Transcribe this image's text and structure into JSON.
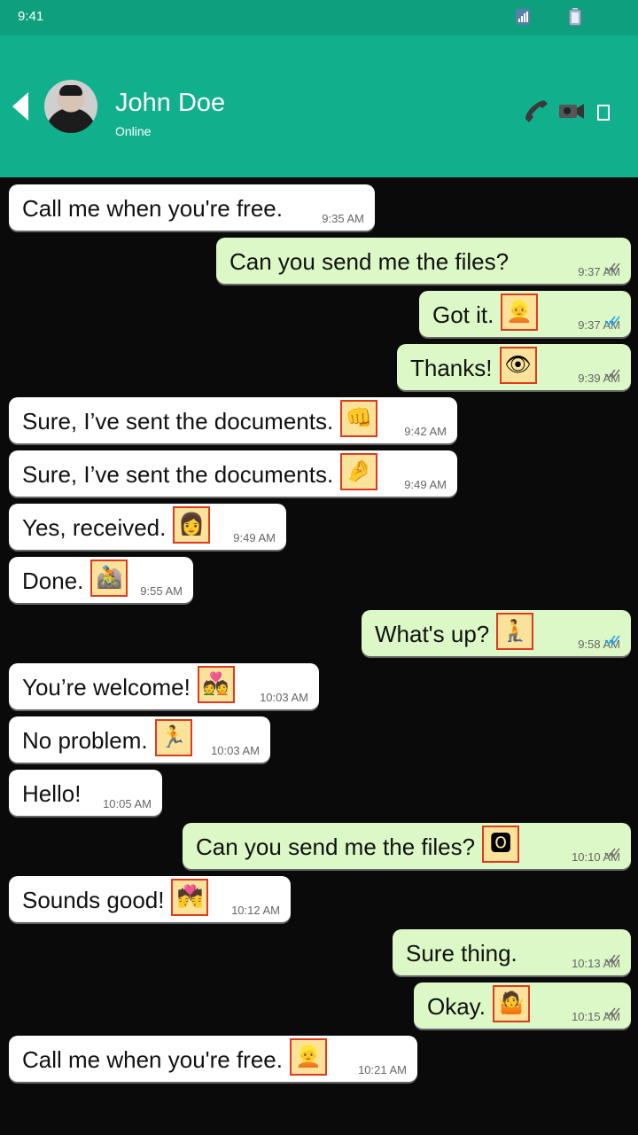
{
  "status_bar": {
    "time": "9:41"
  },
  "contact": {
    "name": "John Doe",
    "status": "Online"
  },
  "messages": [
    {
      "dir": "in",
      "text": "Call me when you're free.",
      "time": "9:35 AM"
    },
    {
      "dir": "out",
      "text": "Can you send me the files?",
      "time": "9:37 AM",
      "ticks": "double-grey"
    },
    {
      "dir": "out",
      "text": "Got it.",
      "time": "9:37 AM",
      "ticks": "double-blue",
      "emoji": "👱"
    },
    {
      "dir": "out",
      "text": "Thanks!",
      "time": "9:39 AM",
      "ticks": "double-grey",
      "emoji": "👁"
    },
    {
      "dir": "in",
      "text": "Sure, I’ve sent the documents.",
      "time": "9:42 AM",
      "emoji": "👊"
    },
    {
      "dir": "in",
      "text": "Sure, I’ve sent the documents.",
      "time": "9:49 AM",
      "emoji": "🤌"
    },
    {
      "dir": "in",
      "text": "Yes, received.",
      "time": "9:49 AM",
      "emoji": "👩"
    },
    {
      "dir": "in",
      "text": "Done.",
      "time": "9:55 AM",
      "emoji": "🚵"
    },
    {
      "dir": "out",
      "text": "What's up?",
      "time": "9:58 AM",
      "ticks": "double-blue",
      "emoji": "🧎"
    },
    {
      "dir": "in",
      "text": "You’re welcome!",
      "time": "10:03 AM",
      "emoji": "💑"
    },
    {
      "dir": "in",
      "text": "No problem.",
      "time": "10:03 AM",
      "emoji": "🏃"
    },
    {
      "dir": "in",
      "text": "Hello!",
      "time": "10:05 AM"
    },
    {
      "dir": "out",
      "text": "Can you send me the files?",
      "time": "10:10 AM",
      "ticks": "double-grey",
      "emoji": "🅾"
    },
    {
      "dir": "in",
      "text": "Sounds good!",
      "time": "10:12 AM",
      "emoji": "💏"
    },
    {
      "dir": "out",
      "text": "Sure thing.",
      "time": "10:13 AM",
      "ticks": "double-grey"
    },
    {
      "dir": "out",
      "text": "Okay.",
      "time": "10:15 AM",
      "ticks": "double-grey",
      "emoji": "🤷"
    },
    {
      "dir": "in",
      "text": "Call me when you're free.",
      "time": "10:21 AM",
      "emoji": "👱"
    }
  ],
  "colors": {
    "header": "#11b08d",
    "status_bar": "#0e9f7e",
    "incoming_bubble": "#ffffff",
    "outgoing_bubble": "#dcf8c6",
    "tick_blue": "#2aa4e8",
    "tick_grey": "#777777"
  }
}
